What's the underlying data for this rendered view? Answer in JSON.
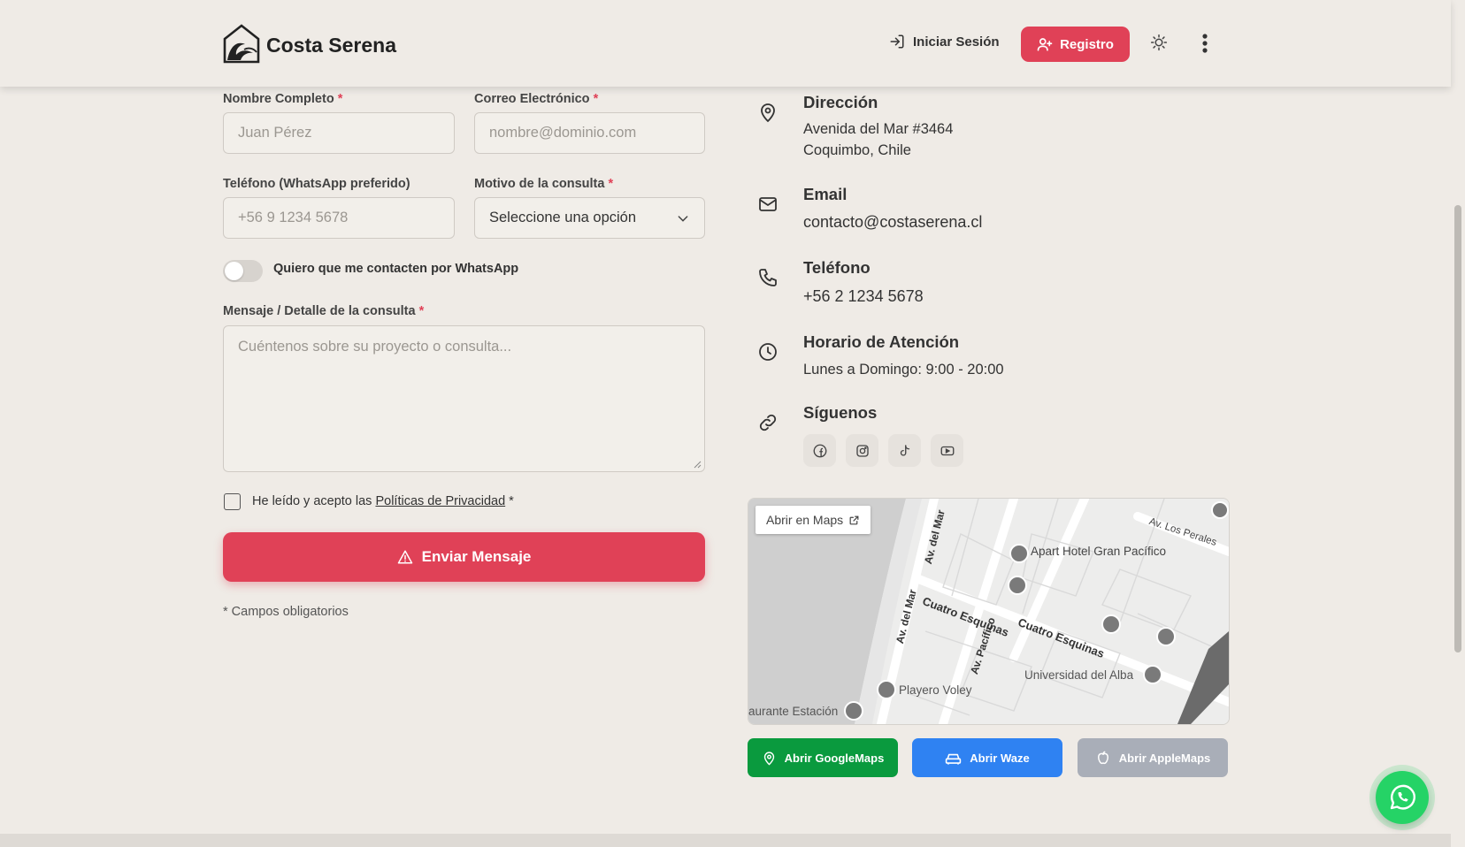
{
  "header": {
    "brand": "Costa Serena",
    "login_label": "Iniciar Sesión",
    "register_label": "Registro"
  },
  "form": {
    "name_label": "Nombre Completo",
    "name_placeholder": "Juan Pérez",
    "email_label": "Correo Electrónico",
    "email_placeholder": "nombre@dominio.com",
    "phone_label": "Teléfono (WhatsApp preferido)",
    "phone_placeholder": "+56 9 1234 5678",
    "reason_label": "Motivo de la consulta",
    "reason_value": "Seleccione una opción",
    "whatsapp_toggle_label": "Quiero que me contacten por WhatsApp",
    "message_label": "Mensaje / Detalle de la consulta",
    "message_placeholder": "Cuéntenos sobre su proyecto o consulta...",
    "consent_prefix": "He leído y acepto las",
    "consent_link": "Políticas de Privacidad",
    "required_mark": "*",
    "submit_label": "Enviar Mensaje",
    "required_note": "* Campos obligatorios"
  },
  "contact": {
    "address_title": "Dirección",
    "address_line1": "Avenida del Mar #3464",
    "address_line2": "Coquimbo, Chile",
    "email_title": "Email",
    "email_value": "contacto@costaserena.cl",
    "phone_title": "Teléfono",
    "phone_value": "+56 2 1234 5678",
    "hours_title": "Horario de Atención",
    "hours_value": "Lunes a Domingo: 9:00 - 20:00",
    "social_title": "Síguenos",
    "social_icons": [
      "facebook-icon",
      "instagram-icon",
      "tiktok-icon",
      "youtube-icon"
    ]
  },
  "map": {
    "open_in_maps": "Abrir en Maps",
    "labels": {
      "hotel": "Apart Hotel Gran Pacífico",
      "street1": "Cuatro Esquinas",
      "street2": "Cuatro Esquinas",
      "av_mar_1": "Av. del Mar",
      "av_mar_2": "Av. del Mar",
      "av_pacifico": "Av. Pacífico",
      "av_perales": "Av. Los Perales",
      "university": "Universidad del Alba",
      "playero": "Playero Voley",
      "restaurant": "aurante Estación"
    },
    "buttons": {
      "google": "Abrir GoogleMaps",
      "waze": "Abrir Waze",
      "apple": "Abrir AppleMaps"
    }
  },
  "colors": {
    "accent": "#e04157",
    "background": "#efebe6",
    "google": "#0a9a3e",
    "waze": "#2f82f2",
    "apple": "#a9aeb8",
    "whatsapp": "#25d366"
  }
}
